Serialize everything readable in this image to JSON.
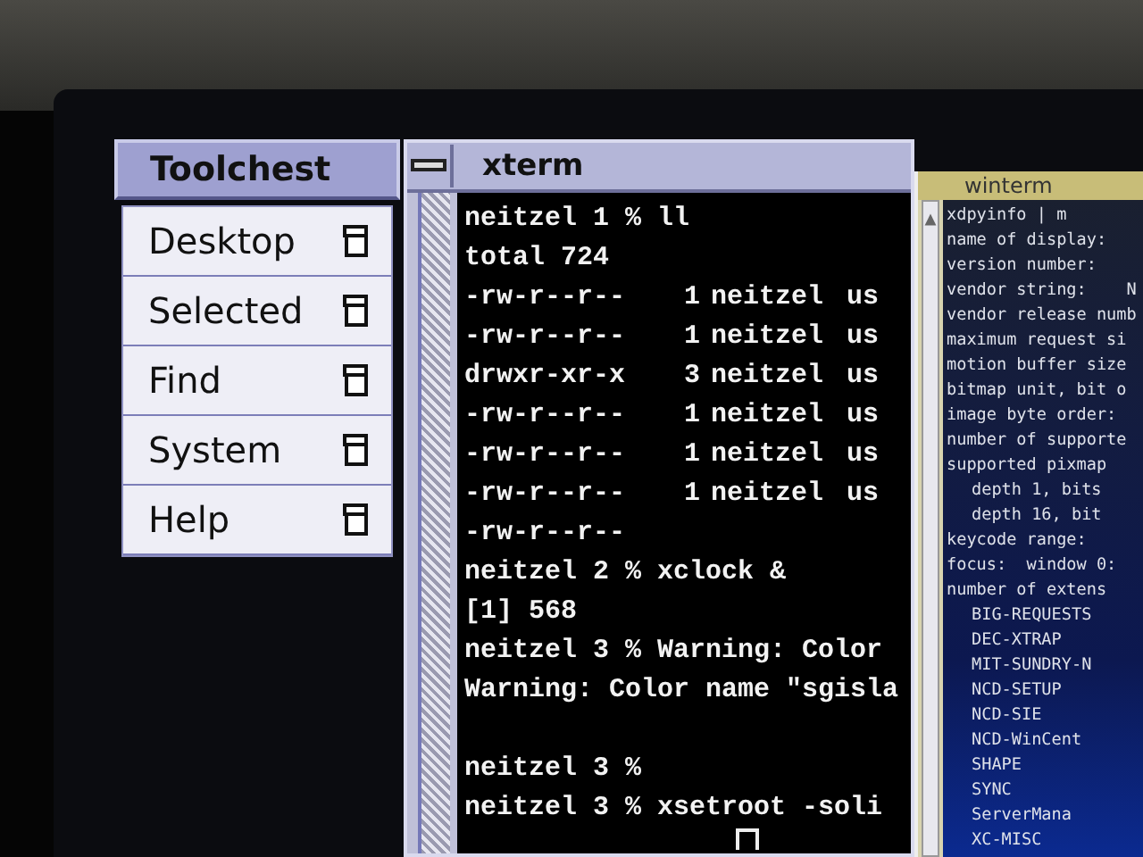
{
  "toolchest": {
    "title": "Toolchest",
    "items": [
      {
        "label": "Desktop"
      },
      {
        "label": "Selected"
      },
      {
        "label": "Find"
      },
      {
        "label": "System"
      },
      {
        "label": "Help"
      }
    ]
  },
  "xterm": {
    "title": "xterm",
    "lines": [
      {
        "kind": "text",
        "text": "neitzel 1 % ll"
      },
      {
        "kind": "text",
        "text": "total 724"
      },
      {
        "kind": "ls",
        "cells": [
          "-rw-r--r--",
          "1",
          "neitzel",
          "us"
        ]
      },
      {
        "kind": "ls",
        "cells": [
          "-rw-r--r--",
          "1",
          "neitzel",
          "us"
        ]
      },
      {
        "kind": "ls",
        "cells": [
          "drwxr-xr-x",
          "3",
          "neitzel",
          "us"
        ]
      },
      {
        "kind": "ls",
        "cells": [
          "-rw-r--r--",
          "1",
          "neitzel",
          "us"
        ]
      },
      {
        "kind": "ls",
        "cells": [
          "-rw-r--r--",
          "1",
          "neitzel",
          "us"
        ]
      },
      {
        "kind": "ls",
        "cells": [
          "-rw-r--r--",
          "1",
          "neitzel",
          "us"
        ]
      },
      {
        "kind": "ls",
        "cells": [
          "-rw-r--r--"
        ]
      },
      {
        "kind": "text",
        "text": "neitzel 2 % xclock &"
      },
      {
        "kind": "text",
        "text": "[1] 568"
      },
      {
        "kind": "text",
        "text": "neitzel 3 % Warning: Color"
      },
      {
        "kind": "text",
        "text": "Warning: Color name \"sgisla"
      },
      {
        "kind": "spaced",
        "text": "neitzel 3 %"
      },
      {
        "kind": "text",
        "text": "neitzel 3 % xsetroot -soli"
      },
      {
        "kind": "cursor"
      }
    ]
  },
  "winterm": {
    "title": "winterm",
    "lines": [
      {
        "text": "xdpyinfo | m"
      },
      {
        "text": "name of display:"
      },
      {
        "text": "version number:"
      },
      {
        "text": "vendor string:    N"
      },
      {
        "text": "vendor release numb"
      },
      {
        "text": "maximum request si"
      },
      {
        "text": "motion buffer size"
      },
      {
        "text": "bitmap unit, bit o"
      },
      {
        "text": "image byte order:"
      },
      {
        "text": "number of supporte"
      },
      {
        "text": "supported pixmap",
        "children": [
          {
            "text": "depth 1, bits"
          },
          {
            "text": "depth 16, bit"
          }
        ]
      },
      {
        "text": "keycode range:"
      },
      {
        "text": "focus:  window 0:"
      },
      {
        "text": "number of extens",
        "children": [
          {
            "text": "BIG-REQUESTS"
          },
          {
            "text": "DEC-XTRAP"
          },
          {
            "text": "MIT-SUNDRY-N"
          },
          {
            "text": "NCD-SETUP"
          },
          {
            "text": "NCD-SIE"
          },
          {
            "text": "NCD-WinCent"
          },
          {
            "text": "SHAPE"
          },
          {
            "text": "SYNC"
          },
          {
            "text": "ServerMana"
          },
          {
            "text": "XC-MISC"
          }
        ]
      }
    ]
  }
}
